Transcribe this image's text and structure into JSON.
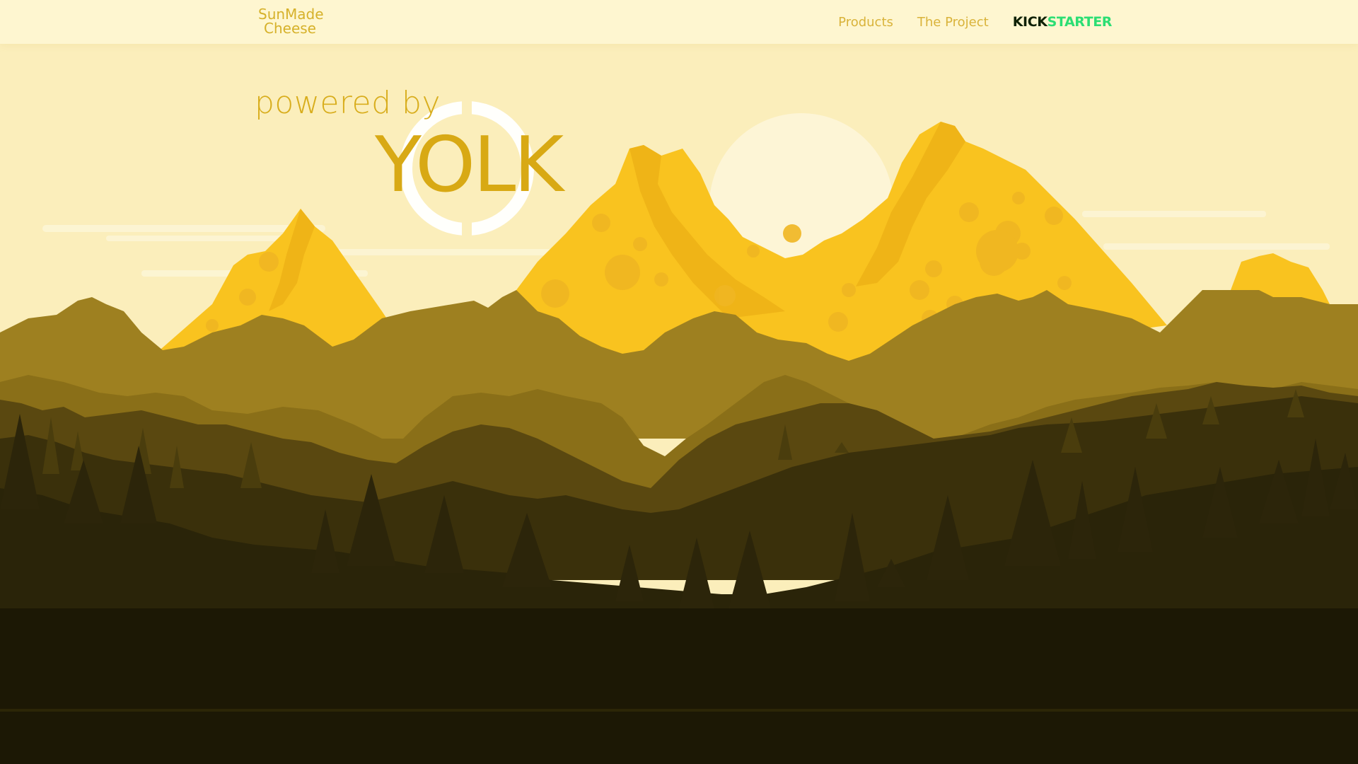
{
  "header": {
    "brand_line1": "SunMade",
    "brand_line2": "Cheese",
    "nav": {
      "products": "Products",
      "project": "The Project",
      "kickstarter_kick": "KICK",
      "kickstarter_starter": "STARTER"
    }
  },
  "hero": {
    "powered_by": "powered by",
    "yolk": "YOLK"
  },
  "colors": {
    "brand_gold": "#d6b12a",
    "cheese": "#f9c31f",
    "kickstarter_green": "#2bde73",
    "forest_dark": "#1b1705"
  }
}
